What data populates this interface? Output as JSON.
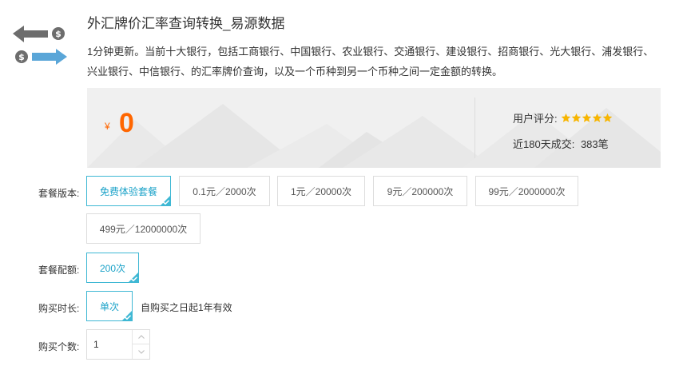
{
  "product": {
    "title": "外汇牌价汇率查询转换_易源数据",
    "description": "1分钟更新。当前十大银行，包括工商银行、中国银行、农业银行、交通银行、建设银行、招商银行、光大银行、浦发银行、兴业银行、中信银行、的汇率牌价查询，以及一个币种到另一个币种之间一定金额的转换。"
  },
  "price": {
    "currency_symbol": "¥",
    "amount": "0",
    "rating_label": "用户评分:",
    "rating_stars": 5,
    "sales_label": "近180天成交:",
    "sales_count": "383笔"
  },
  "package": {
    "label": "套餐版本:",
    "options": [
      {
        "text": "免费体验套餐",
        "selected": true
      },
      {
        "text": "0.1元／2000次",
        "selected": false
      },
      {
        "text": "1元／20000次",
        "selected": false
      },
      {
        "text": "9元／200000次",
        "selected": false
      },
      {
        "text": "99元／2000000次",
        "selected": false
      },
      {
        "text": "499元／12000000次",
        "selected": false
      }
    ]
  },
  "quota": {
    "label": "套餐配额:",
    "options": [
      {
        "text": "200次",
        "selected": true
      }
    ]
  },
  "duration": {
    "label": "购买时长:",
    "options": [
      {
        "text": "单次",
        "selected": true
      }
    ],
    "note": "自购买之日起1年有效"
  },
  "quantity": {
    "label": "购买个数:",
    "value": "1"
  },
  "colors": {
    "accent": "#3fb8d4",
    "price": "#ff6600",
    "star": "#f7b500",
    "arrow_gray": "#6d6d6d",
    "arrow_blue": "#5aa6d8"
  },
  "icons": {
    "logo": "currency-exchange-icon",
    "star": "star-icon",
    "check": "check-icon",
    "up": "chevron-up-icon",
    "down": "chevron-down-icon"
  }
}
